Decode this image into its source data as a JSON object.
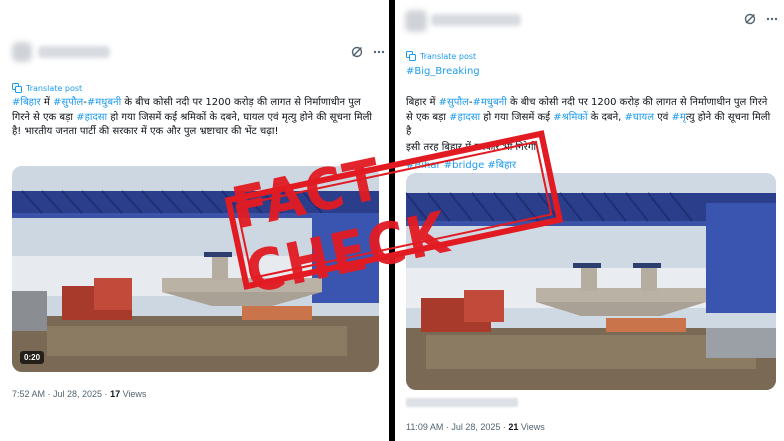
{
  "stamp": {
    "text": "FACT CHECK",
    "color": "#e21b23"
  },
  "left_post": {
    "translate": "Translate post",
    "text_parts": [
      {
        "t": "#बिहार",
        "tag": true
      },
      {
        "t": " में ",
        "tag": false
      },
      {
        "t": "#सुपौल",
        "tag": true
      },
      {
        "t": "-",
        "tag": false
      },
      {
        "t": "#मधुबनी",
        "tag": true
      },
      {
        "t": " के बीच कोसी नदी पर 1200 करोड़ की लागत से निर्माणाधीन पुल गिरने से एक बड़ा ",
        "tag": false
      },
      {
        "t": "#हादसा",
        "tag": true
      },
      {
        "t": " हो गया जिसमें कई श्रमिकों के दबने, घायल एवं मृत्यु होने की सूचना मिली है!  भारतीय जनता पार्टी की सरकार में एक और पुल भ्रष्टाचार की भेंट चढ़ा!",
        "tag": false
      }
    ],
    "video_duration": "0:20",
    "timestamp": "7:52 AM · Jul 28, 2025 · ",
    "views_count": "17",
    "views_label": " Views"
  },
  "right_post": {
    "translate": "Translate post",
    "hashtag_line": "#Big_Breaking",
    "text_parts": [
      {
        "t": "बिहार में ",
        "tag": false
      },
      {
        "t": "#सुपौल",
        "tag": true
      },
      {
        "t": "-",
        "tag": false
      },
      {
        "t": "#मधुबनी",
        "tag": true
      },
      {
        "t": " के बीच कोसी नदी पर 1200 करोड़ की लागत से निर्माणाधीन पुल गिरने से एक बड़ा ",
        "tag": false
      },
      {
        "t": "#हादसा",
        "tag": true
      },
      {
        "t": " हो गया जिसमें कई ",
        "tag": false
      },
      {
        "t": "#श्रमिकों",
        "tag": true
      },
      {
        "t": " के दबने, ",
        "tag": false
      },
      {
        "t": "#घायल",
        "tag": true
      },
      {
        "t": " एवं ",
        "tag": false
      },
      {
        "t": "#मृ",
        "tag": true
      },
      {
        "t": "त्यु होने की सूचना मिली है",
        "tag": false
      }
    ],
    "line2": "इसी तरह बिहार में सरकार भी गिरेगी",
    "tags_line": "#Bihar #bridge #बिहार",
    "timestamp": "11:09 AM · Jul 28, 2025 · ",
    "views_count": "21",
    "views_label": " Views"
  },
  "colors": {
    "link": "#1d9bf0",
    "text": "#0f1419",
    "muted": "#536471",
    "crane_blue": "#2a3e8c"
  },
  "icons": [
    "grok-icon",
    "more-icon",
    "translate-icon"
  ]
}
